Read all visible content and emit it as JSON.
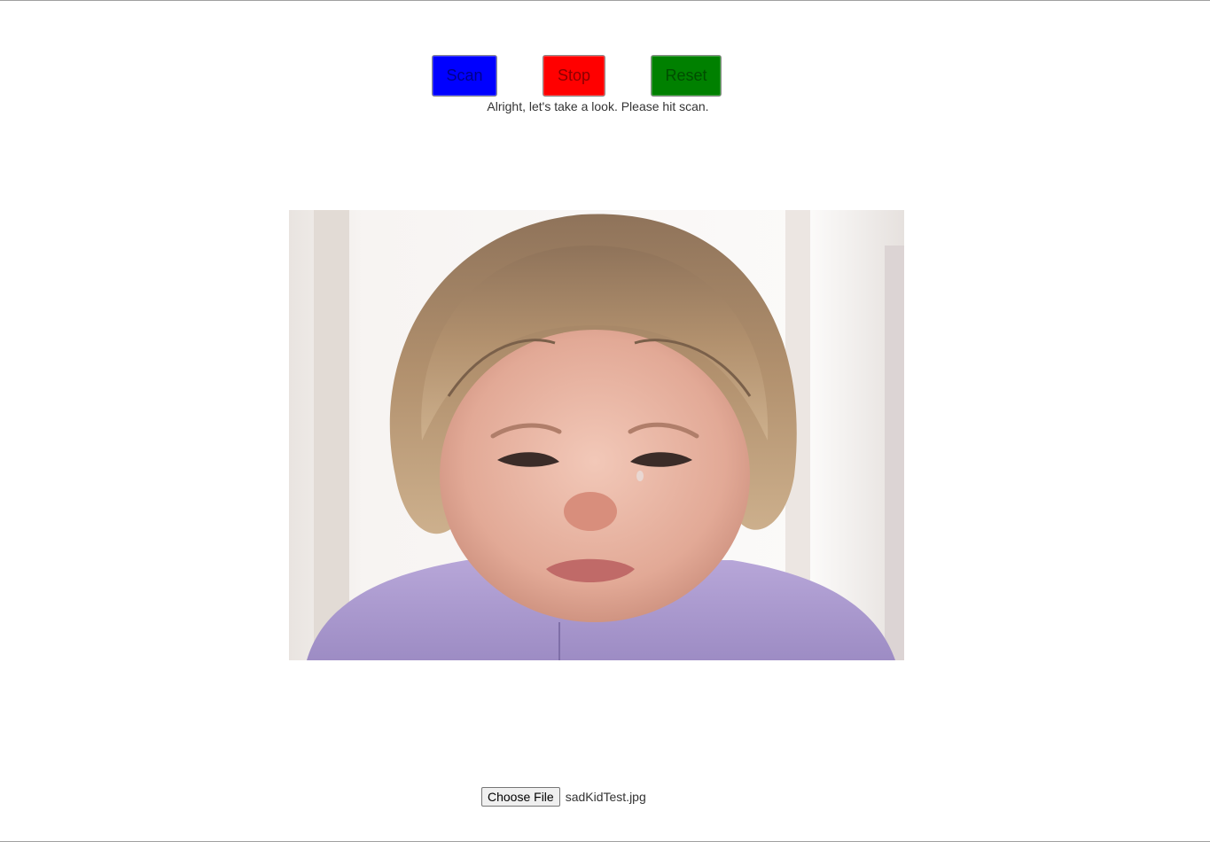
{
  "controls": {
    "scan_label": "Scan",
    "stop_label": "Stop",
    "reset_label": "Reset"
  },
  "status": {
    "message": "Alright, let's take a look. Please hit scan."
  },
  "photo": {
    "subject": "crying child"
  },
  "file_input": {
    "button_label": "Choose File",
    "selected_file": "sadKidTest.jpg"
  },
  "colors": {
    "scan": "#0000ff",
    "stop": "#ff0000",
    "reset": "#008000"
  }
}
